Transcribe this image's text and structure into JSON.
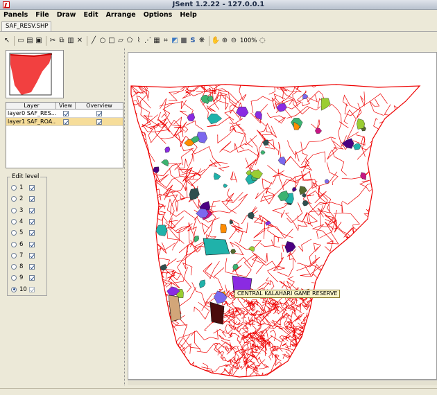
{
  "window": {
    "title": "JSent 1.2.22 - 127.0.0.1"
  },
  "menu": [
    "Panels",
    "File",
    "Draw",
    "Edit",
    "Arrange",
    "Options",
    "Help"
  ],
  "document_tab": "SAF_RESV.SHP",
  "toolbar": {
    "tools": [
      {
        "name": "select-arrow-icon",
        "glyph": "↖"
      },
      {
        "name": "open-icon",
        "glyph": "▭"
      },
      {
        "name": "properties-icon",
        "glyph": "▤"
      },
      {
        "name": "save-icon",
        "glyph": "▣"
      },
      {
        "name": "cut-icon",
        "glyph": "✂"
      },
      {
        "name": "copy-icon",
        "glyph": "⧉"
      },
      {
        "name": "paste-icon",
        "glyph": "▥"
      },
      {
        "name": "delete-icon",
        "glyph": "✕"
      },
      {
        "name": "line-icon",
        "glyph": "╱"
      },
      {
        "name": "ellipse-icon",
        "glyph": "○"
      },
      {
        "name": "rectangle-icon",
        "glyph": "□"
      },
      {
        "name": "parallelogram-icon",
        "glyph": "▱"
      },
      {
        "name": "polygon-icon",
        "glyph": "⬠"
      },
      {
        "name": "polyline-icon",
        "glyph": "⌇"
      },
      {
        "name": "vertex-icon",
        "glyph": "⋰"
      },
      {
        "name": "grid-icon",
        "glyph": "▦"
      },
      {
        "name": "mesh-icon",
        "glyph": "⌗"
      },
      {
        "name": "image-icon",
        "glyph": "◩"
      },
      {
        "name": "fill-icon",
        "glyph": "■"
      },
      {
        "name": "style-icon",
        "glyph": "S"
      },
      {
        "name": "symbol-icon",
        "glyph": "❋"
      },
      {
        "name": "pan-icon",
        "glyph": "✋"
      },
      {
        "name": "zoom-in-icon",
        "glyph": "⊕"
      },
      {
        "name": "zoom-out-icon",
        "glyph": "⊖"
      }
    ],
    "zoom_label": "100%"
  },
  "layers": {
    "headers": [
      "Layer",
      "View",
      "Overview"
    ],
    "rows": [
      {
        "name": "layer0 SAF_RES...",
        "view": true,
        "overview": true,
        "selected": false
      },
      {
        "name": "layer1 SAF_ROA...",
        "view": true,
        "overview": true,
        "selected": true
      }
    ]
  },
  "edit_level": {
    "title": "Edit level",
    "levels": [
      {
        "n": "1",
        "checked": true,
        "selected": false
      },
      {
        "n": "2",
        "checked": true,
        "selected": false
      },
      {
        "n": "3",
        "checked": true,
        "selected": false
      },
      {
        "n": "4",
        "checked": true,
        "selected": false
      },
      {
        "n": "5",
        "checked": true,
        "selected": false
      },
      {
        "n": "6",
        "checked": true,
        "selected": false
      },
      {
        "n": "7",
        "checked": true,
        "selected": false
      },
      {
        "n": "8",
        "checked": true,
        "selected": false
      },
      {
        "n": "9",
        "checked": true,
        "selected": false
      },
      {
        "n": "10",
        "checked": true,
        "selected": true
      }
    ]
  },
  "map": {
    "tooltip": "CENTRAL KALAHARI GAME RESERVE",
    "road_color": "#ee0000",
    "reserve_colors": [
      "#8a2be2",
      "#20b2aa",
      "#556b2f",
      "#4b0082",
      "#3cb371",
      "#c71585",
      "#7b68ee",
      "#2f4f4f",
      "#9acd32",
      "#ff8c00"
    ]
  }
}
